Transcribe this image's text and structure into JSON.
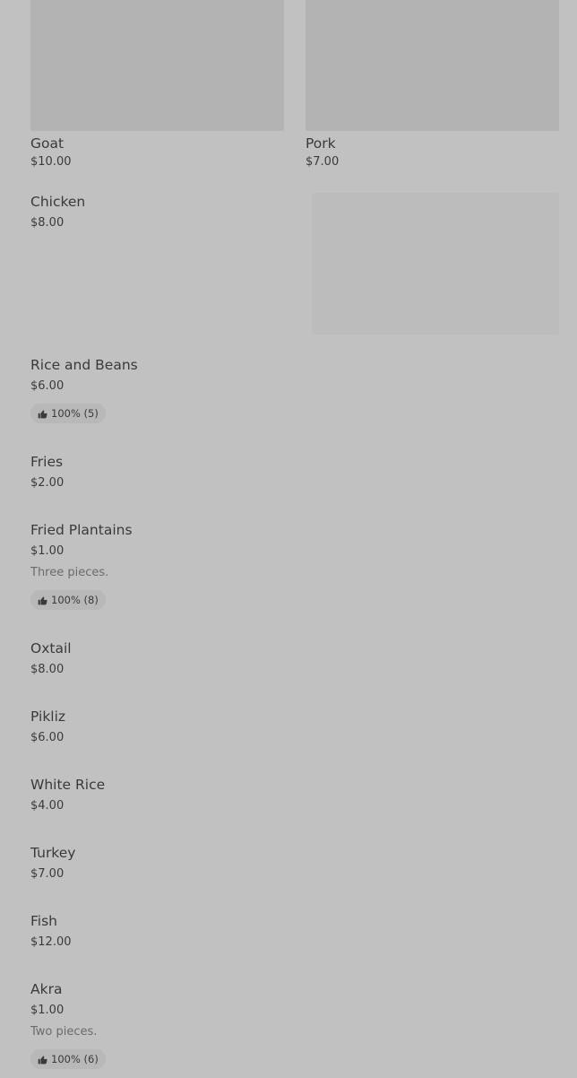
{
  "featured": [
    {
      "name": "Goat",
      "price": "$10.00"
    },
    {
      "name": "Pork",
      "price": "$7.00"
    }
  ],
  "menu": [
    {
      "name": "Chicken",
      "price": "$8.00"
    },
    {
      "name": "Rice and Beans",
      "price": "$6.00",
      "badge": "100% (5)"
    },
    {
      "name": "Fries",
      "price": "$2.00"
    },
    {
      "name": "Fried Plantains",
      "price": "$1.00",
      "description": "Three pieces.",
      "badge": "100% (8)"
    },
    {
      "name": "Oxtail",
      "price": "$8.00"
    },
    {
      "name": "Pikliz",
      "price": "$6.00"
    },
    {
      "name": "White Rice",
      "price": "$4.00"
    },
    {
      "name": "Turkey",
      "price": "$7.00"
    },
    {
      "name": "Fish",
      "price": "$12.00"
    },
    {
      "name": "Akra",
      "price": "$1.00",
      "description": "Two pieces.",
      "badge": "100% (6)"
    }
  ],
  "icons": {
    "rating": "thumbs-up-icon"
  },
  "colors": {
    "background": "#c1c1c1",
    "placeholder": "#b3b3b3",
    "text": "#3a3a3a",
    "muted": "#6b6b6b"
  }
}
